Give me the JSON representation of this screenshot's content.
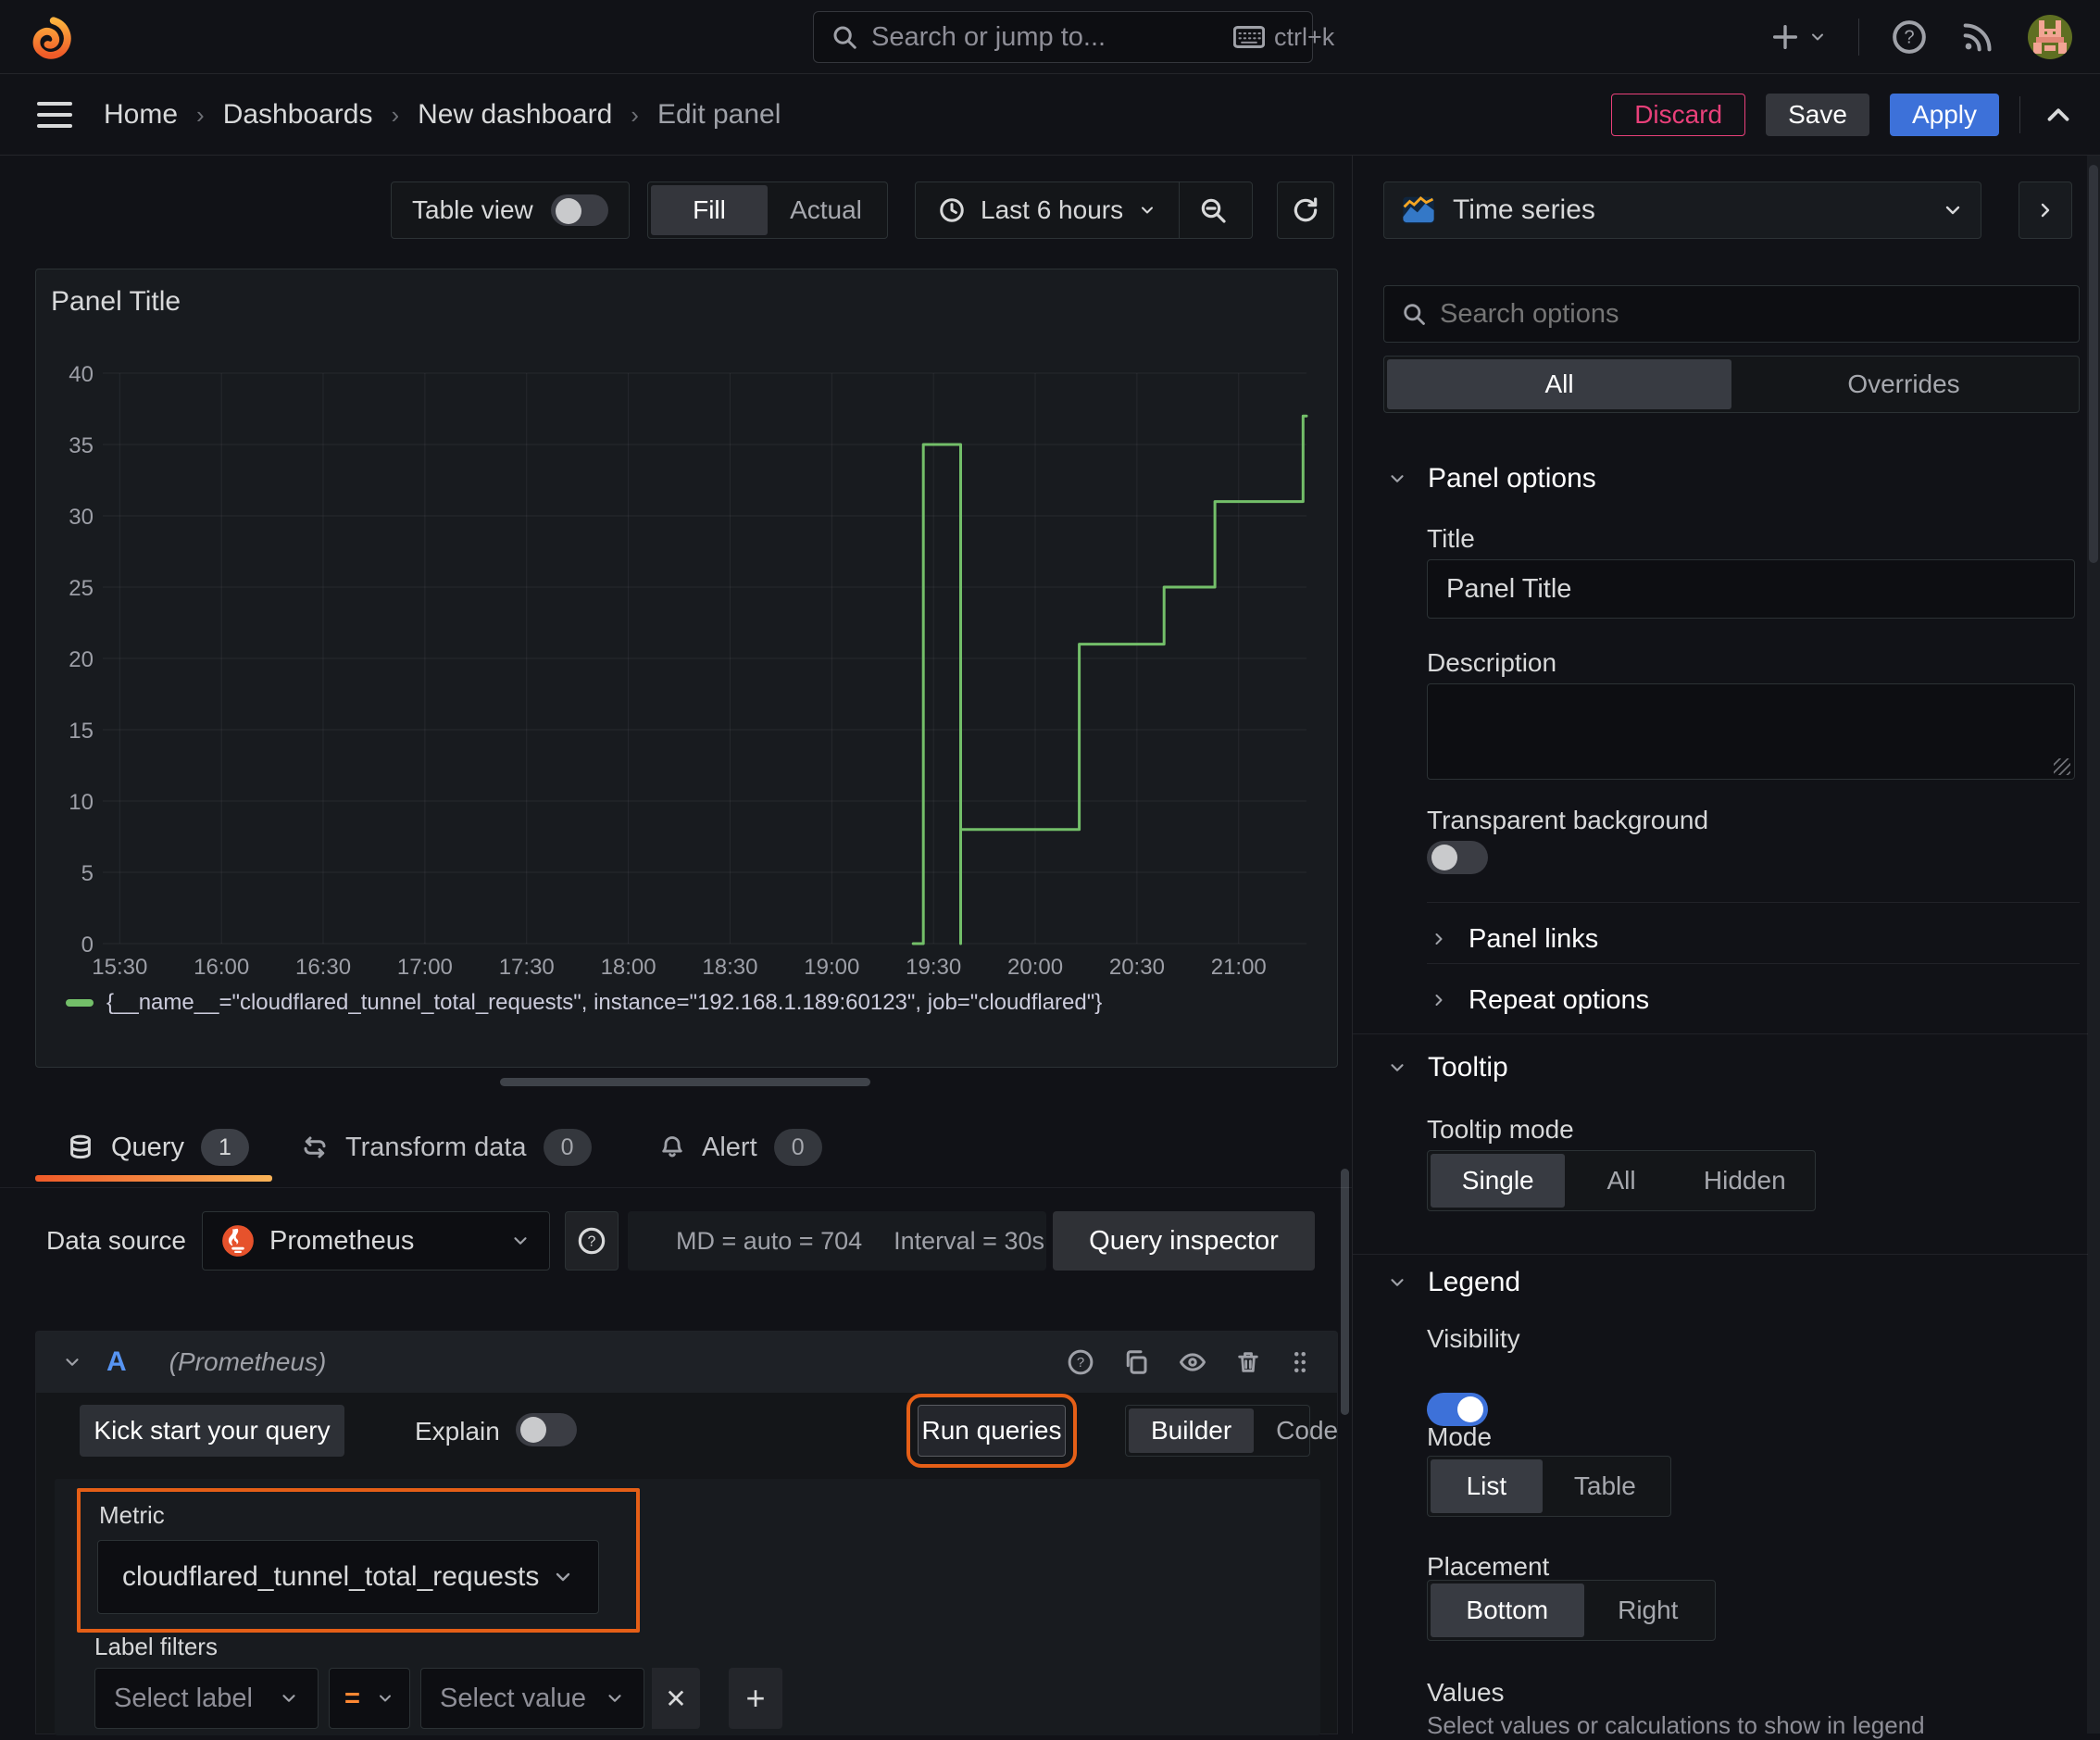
{
  "nav": {
    "search_placeholder": "Search or jump to...",
    "shortcut": "ctrl+k"
  },
  "breadcrumb": {
    "items": [
      "Home",
      "Dashboards",
      "New dashboard",
      "Edit panel"
    ]
  },
  "actions": {
    "discard": "Discard",
    "save": "Save",
    "apply": "Apply"
  },
  "toolbar": {
    "table_view": "Table view",
    "fill": "Fill",
    "actual": "Actual",
    "time_range": "Last 6 hours"
  },
  "panel": {
    "title": "Panel Title"
  },
  "chart_data": {
    "type": "line",
    "title": "Panel Title",
    "line_style": "step",
    "grid": true,
    "legend_position": "bottom",
    "x_ticks": [
      "15:30",
      "16:00",
      "16:30",
      "17:00",
      "17:30",
      "18:00",
      "18:30",
      "19:00",
      "19:30",
      "20:00",
      "20:30",
      "21:00"
    ],
    "x_range_minutes": [
      925,
      1280
    ],
    "y_ticks": [
      0,
      5,
      10,
      15,
      20,
      25,
      30,
      35,
      40
    ],
    "ylim": [
      0,
      40
    ],
    "series": [
      {
        "name": "{__name__=\"cloudflared_tunnel_total_requests\", instance=\"192.168.1.189:60123\", job=\"cloudflared\"}",
        "color": "#73bf69",
        "points_time_value": [
          [
            "19:24",
            0
          ],
          [
            "19:27",
            0
          ],
          [
            "19:27",
            35
          ],
          [
            "19:38",
            35
          ],
          [
            "19:38",
            0
          ],
          [
            "19:38",
            8
          ],
          [
            "20:13",
            8
          ],
          [
            "20:13",
            21
          ],
          [
            "20:38",
            21
          ],
          [
            "20:38",
            25
          ],
          [
            "20:53",
            25
          ],
          [
            "20:53",
            31
          ],
          [
            "21:19",
            31
          ],
          [
            "21:19",
            37
          ],
          [
            "21:20",
            37
          ]
        ]
      }
    ]
  },
  "tabs": {
    "query": {
      "label": "Query",
      "count": "1"
    },
    "transform": {
      "label": "Transform data",
      "count": "0"
    },
    "alert": {
      "label": "Alert",
      "count": "0"
    }
  },
  "datasource": {
    "label": "Data source",
    "name": "Prometheus",
    "stats_md": "MD = auto = 704",
    "stats_interval": "Interval = 30s",
    "inspector": "Query inspector"
  },
  "query": {
    "ref_id": "A",
    "ds_hint": "(Prometheus)",
    "kick_start": "Kick start your query",
    "explain": "Explain",
    "run_queries": "Run queries",
    "builder": "Builder",
    "code": "Code",
    "metric_label": "Metric",
    "metric_value": "cloudflared_tunnel_total_requests",
    "label_filters": "Label filters",
    "select_label": "Select label",
    "operator": "=",
    "select_value": "Select value",
    "remove": "✕",
    "add": "+"
  },
  "options": {
    "viz_name": "Time series",
    "search_placeholder": "Search options",
    "tabs": {
      "all": "All",
      "overrides": "Overrides"
    },
    "panel_options": {
      "title": "Panel options",
      "title_label": "Title",
      "title_value": "Panel Title",
      "description_label": "Description",
      "transparent_label": "Transparent background"
    },
    "panel_links": "Panel links",
    "repeat_options": "Repeat options",
    "tooltip": {
      "title": "Tooltip",
      "mode_label": "Tooltip mode",
      "modes": [
        "Single",
        "All",
        "Hidden"
      ],
      "selected": "Single"
    },
    "legend": {
      "title": "Legend",
      "visibility_label": "Visibility",
      "mode_label": "Mode",
      "modes": [
        "List",
        "Table"
      ],
      "selected_mode": "List",
      "placement_label": "Placement",
      "placements": [
        "Bottom",
        "Right"
      ],
      "selected_placement": "Bottom",
      "values_label": "Values",
      "values_hint": "Select values or calculations to show in legend"
    }
  },
  "annotations": {
    "highlight_color": "#e55f17",
    "highlighted": [
      "run-queries-button",
      "metric-select"
    ]
  },
  "colors": {
    "background": "#111217",
    "panel": "#181b1f",
    "series_green": "#73bf69",
    "primary_blue": "#3d71d9",
    "danger_pink": "#e9407a",
    "highlight_orange": "#e55f17"
  }
}
